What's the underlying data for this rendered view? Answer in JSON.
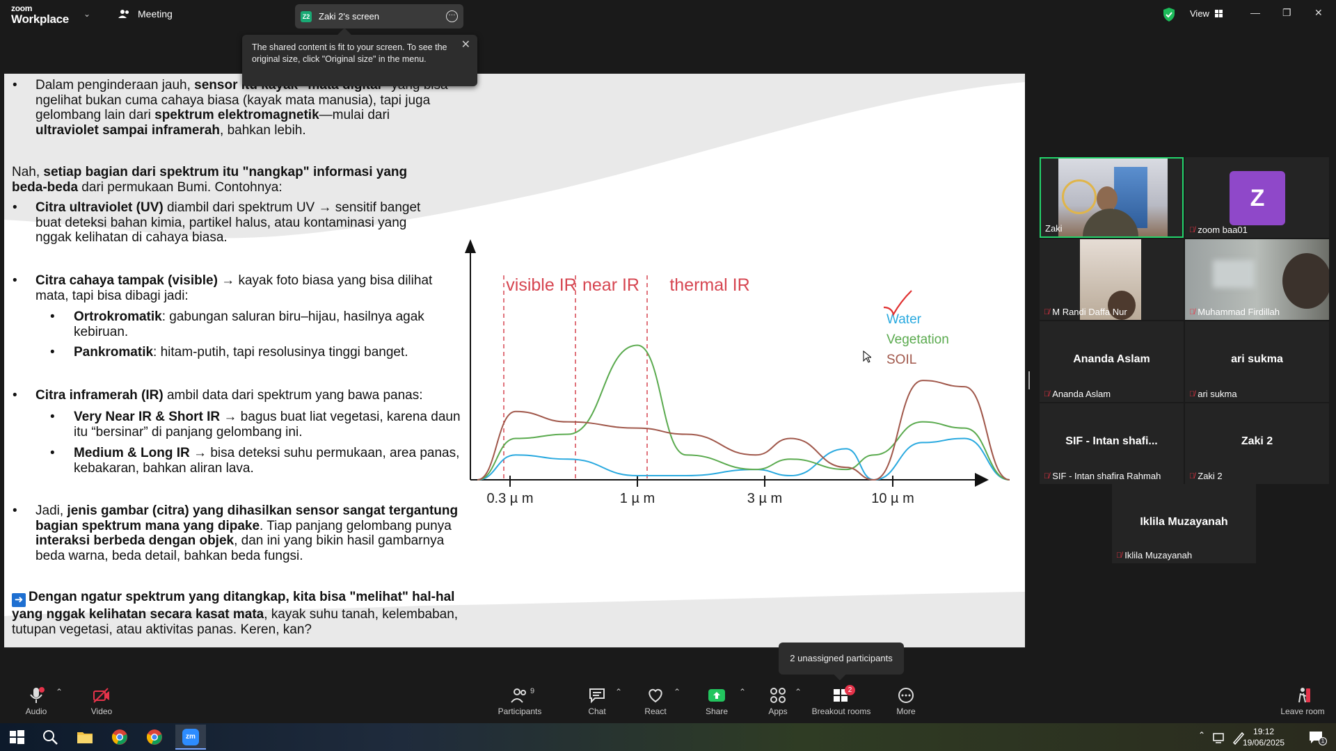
{
  "app": {
    "logo_line1": "zoom",
    "logo_line2": "Workplace",
    "meeting_label": "Meeting",
    "screen_tab_badge": "Z2",
    "screen_tab_label": "Zaki 2's screen",
    "tooltip_text": "The shared content is fit to your screen. To see the original size, click \"Original size\" in the menu.",
    "view_label": "View"
  },
  "slide": {
    "p1": {
      "a": "Dalam penginderaan jauh, ",
      "b": "sensor itu kayak \"mata digital\"",
      "c": " yang bisa ngelihat bukan cuma cahaya biasa (kayak mata manusia), tapi juga gelombang lain dari ",
      "d": "spektrum elektromagnetik",
      "e": "—mulai dari ",
      "f": "ultraviolet sampai inframerah",
      "g": ", bahkan lebih."
    },
    "p2": {
      "a": "Nah, ",
      "b": "setiap bagian dari spektrum itu \"nangkap\" informasi yang beda-beda",
      "c": " dari permukaan Bumi. Contohnya:"
    },
    "uv": {
      "b": "Citra ultraviolet (UV)",
      "t": " diambil dari spektrum UV → sensitif banget buat deteksi bahan kimia, partikel halus, atau kontaminasi yang nggak kelihatan di cahaya biasa."
    },
    "vis": {
      "b": "Citra cahaya tampak (visible)",
      "t": " → kayak foto biasa yang bisa dilihat mata, tapi bisa dibagi jadi:"
    },
    "orto": {
      "b": "Ortrokromatik",
      "t": ": gabungan saluran biru–hijau, hasilnya agak kebiruan."
    },
    "pan": {
      "b": "Pankromatik",
      "t": ": hitam-putih, tapi resolusinya tinggi banget."
    },
    "ir": {
      "b": "Citra inframerah (IR)",
      "t": " ambil data dari spektrum yang bawa panas:"
    },
    "vnir": {
      "b": "Very Near IR & Short IR",
      "t": " → bagus buat liat vegetasi, karena daun itu “bersinar” di panjang gelombang ini."
    },
    "mlir": {
      "b": "Medium & Long IR",
      "t": " → bisa deteksi suhu permukaan, area panas, kebakaran, bahkan aliran lava."
    },
    "jadi": {
      "a": "Jadi, ",
      "b": "jenis gambar (citra) yang dihasilkan sensor sangat tergantung bagian spektrum mana yang dipake",
      "c": ". Tiap panjang gelombang punya ",
      "d": "interaksi berbeda dengan objek",
      "e": ", dan ini yang bikin hasil gambarnya beda warna, beda detail, bahkan beda fungsi."
    },
    "final": {
      "b": "Dengan ngatur spektrum yang ditangkap, kita bisa \"melihat\" hal-hal yang nggak kelihatan secara kasat mata",
      "c": ", kayak suhu tanah, kelembaban, tutupan vegetasi, atau aktivitas panas. Keren, kan?"
    }
  },
  "chart_data": {
    "type": "line",
    "region_labels": [
      "visible IR",
      "near IR",
      "thermal IR"
    ],
    "x_ticks": [
      "0.3 µ m",
      "1 µ m",
      "3 µ m",
      "10 µ m"
    ],
    "legend": [
      "Water",
      "Vegetation",
      "SOIL"
    ],
    "colors": {
      "water": "#29a9df",
      "vegetation": "#5aaa4e",
      "soil": "#a0574a",
      "boundary": "#d64550",
      "check": "#e03030"
    },
    "series": [
      {
        "name": "Water",
        "values": [
          0.0,
          0.12,
          0.1,
          0.02,
          0.02,
          0.05,
          0.02,
          0.15,
          0.0,
          0.18,
          0.2,
          0.0
        ]
      },
      {
        "name": "Vegetation",
        "values": [
          0.0,
          0.2,
          0.22,
          0.65,
          0.12,
          0.05,
          0.1,
          0.05,
          0.12,
          0.28,
          0.25,
          0.0
        ]
      },
      {
        "name": "SOIL",
        "values": [
          0.0,
          0.33,
          0.28,
          0.25,
          0.22,
          0.12,
          0.2,
          0.06,
          0.0,
          0.48,
          0.45,
          0.0
        ]
      }
    ]
  },
  "participants": [
    {
      "name": "Zaki",
      "type": "video"
    },
    {
      "name": "zoom baa01",
      "initial": "Z",
      "type": "avatar"
    },
    {
      "name": "M Randi Daffa Nur",
      "type": "video"
    },
    {
      "name": "Muhammad Firdillah",
      "type": "video"
    },
    {
      "name": "Ananda Aslam",
      "big": "Ananda Aslam",
      "type": "name"
    },
    {
      "name": "ari sukma",
      "big": "ari sukma",
      "type": "name"
    },
    {
      "name": "SIF - Intan shafira Rahmah",
      "big": "SIF - Intan shafi...",
      "type": "name"
    },
    {
      "name": "Zaki 2",
      "big": "Zaki 2",
      "type": "name"
    },
    {
      "name": "Iklila Muzayanah",
      "big": "Iklila Muzayanah",
      "type": "name"
    }
  ],
  "unassigned_tooltip": "2 unassigned participants",
  "toolbar": {
    "audio": "Audio",
    "video": "Video",
    "participants": "Participants",
    "participants_count": "9",
    "chat": "Chat",
    "react": "React",
    "share": "Share",
    "apps": "Apps",
    "breakout": "Breakout rooms",
    "breakout_badge": "2",
    "more": "More",
    "leave": "Leave room"
  },
  "taskbar": {
    "time": "19:12",
    "date": "19/06/2025",
    "notif_count": "1"
  }
}
